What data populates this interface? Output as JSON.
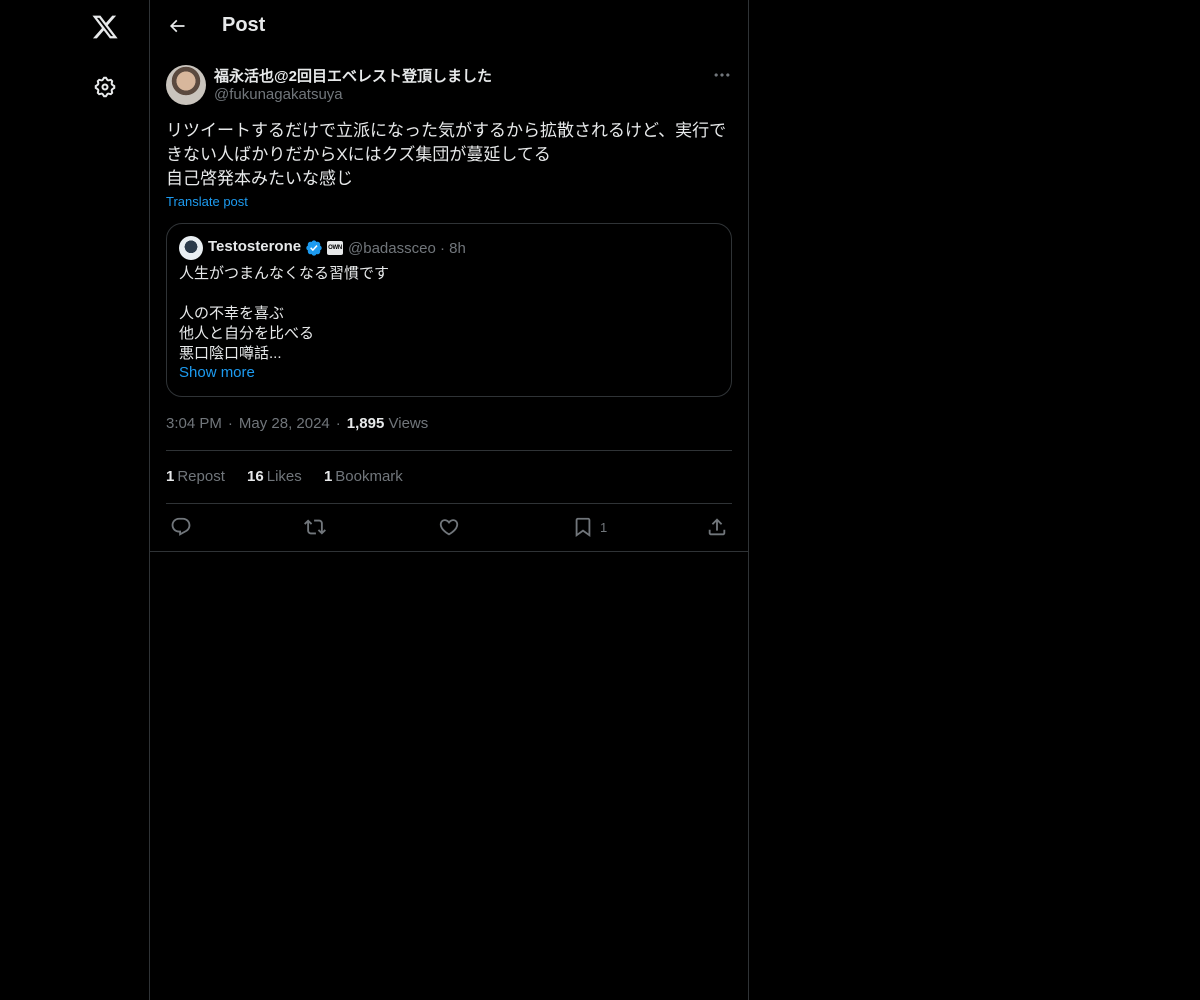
{
  "nav": {
    "logo_icon": "x-logo-icon",
    "settings_icon": "gear-icon"
  },
  "header": {
    "title": "Post"
  },
  "post": {
    "author": {
      "name": "福永活也@2回目エベレスト登頂しました",
      "handle": "@fukunagakatsuya"
    },
    "text_lines": [
      "リツイートするだけで立派になった気がするから拡散されるけど、実行できない人ばかりだからXにはクズ集団が蔓延してる",
      "自己啓発本みたいな感じ"
    ],
    "translate_label": "Translate post",
    "quote": {
      "name": "Testosterone",
      "badge_text": "OWN",
      "handle": "@badassceo",
      "time": "8h",
      "handle_time": "@badassceo · 8h",
      "lines": [
        "人生がつまんなくなる習慣です",
        "",
        "人の不幸を喜ぶ",
        "他人と自分を比べる",
        "悪口陰口噂話..."
      ],
      "show_more": "Show more"
    },
    "time": "3:04 PM",
    "date": "May 28, 2024",
    "views_count": "1,895",
    "views_label": "Views",
    "stats": {
      "reposts_count": "1",
      "reposts_label": "Repost",
      "likes_count": "16",
      "likes_label": "Likes",
      "bookmarks_count": "1",
      "bookmarks_label": "Bookmark"
    },
    "actions": {
      "bookmark_count": "1"
    }
  },
  "colors": {
    "background": "#000000",
    "text": "#e7e9ea",
    "muted": "#71767b",
    "border": "#2f3336",
    "accent": "#1d9bf0"
  }
}
